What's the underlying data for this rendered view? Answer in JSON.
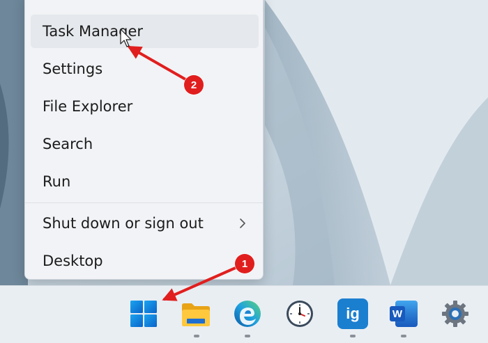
{
  "context_menu": {
    "items": [
      {
        "label": "Task Manager",
        "hovered": true
      },
      {
        "label": "Settings"
      },
      {
        "label": "File Explorer"
      },
      {
        "label": "Search"
      },
      {
        "label": "Run"
      },
      {
        "label": "Shut down or sign out",
        "has_submenu": true
      },
      {
        "label": "Desktop"
      }
    ]
  },
  "annotations": {
    "step_1": "1",
    "step_2": "2",
    "color": "#e11e1e"
  },
  "taskbar": {
    "icons": [
      {
        "name": "start-windows-icon"
      },
      {
        "name": "file-explorer-icon"
      },
      {
        "name": "edge-browser-icon"
      },
      {
        "name": "clock-icon"
      },
      {
        "name": "ig-app-icon",
        "text": "ig"
      },
      {
        "name": "word-icon",
        "text": "W"
      },
      {
        "name": "settings-gear-icon"
      }
    ]
  }
}
